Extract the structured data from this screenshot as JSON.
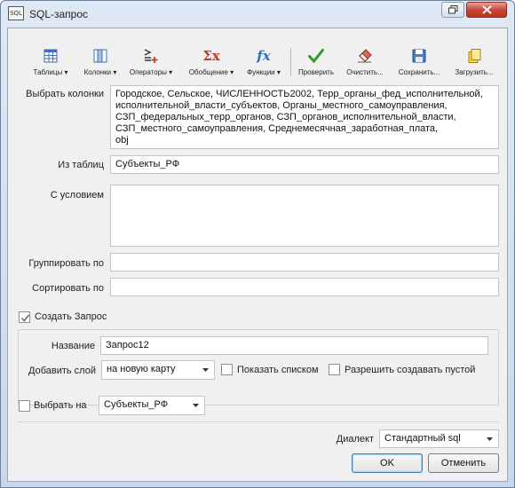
{
  "window": {
    "title": "SQL-запрос",
    "icon_text": "SQL"
  },
  "toolbar": {
    "items": [
      {
        "label": "Таблицы ▾",
        "icon": "table-icon"
      },
      {
        "label": "Колонки ▾",
        "icon": "columns-icon"
      },
      {
        "label": "Операторы ▾",
        "icon": "operators-icon"
      },
      {
        "label": "Обобщение ▾",
        "icon": "sigma-icon"
      },
      {
        "label": "Функции ▾",
        "icon": "function-icon"
      },
      {
        "label": "Проверить",
        "icon": "check-icon"
      },
      {
        "label": "Очистить...",
        "icon": "eraser-icon"
      },
      {
        "label": "Сохранить...",
        "icon": "save-icon"
      },
      {
        "label": "Загрузить...",
        "icon": "load-icon"
      }
    ],
    "function_glyph": "fx",
    "sigma_glyph": "Σx"
  },
  "form": {
    "select_columns_label": "Выбрать колонки",
    "select_columns_lines": [
      "Городское, Сельское, ЧИСЛЕННОСТЬ2002, Терр_органы_фед_исполнительной,",
      "исполнительной_власти_субъектов, Органы_местного_самоуправления,",
      "СЗП_федеральных_терр_органов, СЗП_органов_исполнительной_власти,",
      "СЗП_местного_самоуправления, Среднемесячная_заработная_плата,",
      "obj"
    ],
    "from_tables_label": "Из таблиц",
    "from_tables_value": "Субъекты_РФ",
    "where_label": "С условием",
    "where_value": "",
    "group_by_label": "Группировать по",
    "group_by_value": "",
    "order_by_label": "Сортировать по",
    "order_by_value": ""
  },
  "create_query": {
    "checkbox_label": "Создать Запрос",
    "checked": true,
    "name_label": "Название",
    "name_value": "Запрос12",
    "add_layer_label": "Добавить слой",
    "add_layer_value": "на новую карту",
    "show_as_list_label": "Показать списком",
    "show_as_list_checked": false,
    "allow_empty_label": "Разрешить создавать пустой",
    "allow_empty_checked": false
  },
  "select_on": {
    "checkbox_label": "Выбрать на",
    "checked": false,
    "value": "Субъекты_РФ"
  },
  "dialect": {
    "label": "Диалект",
    "value": "Стандартный sql"
  },
  "buttons": {
    "ok": "OK",
    "cancel": "Отменить"
  },
  "colors": {
    "close_button": "#c9463a",
    "check_green": "#2e9a2e",
    "function_blue": "#2f6fbf",
    "sigma_red": "#c23a2a"
  }
}
